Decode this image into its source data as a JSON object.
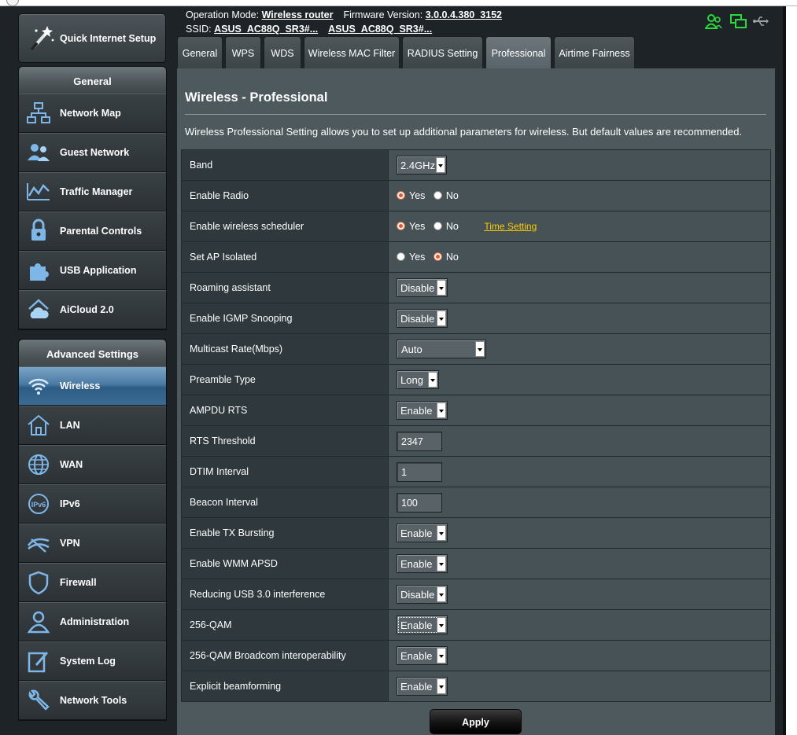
{
  "header": {
    "op_mode_label": "Operation Mode:",
    "op_mode_value": "Wireless router",
    "fw_label": "Firmware Version:",
    "fw_value": "3.0.0.4.380_3152",
    "ssid_label": "SSID:",
    "ssid_1": "ASUS_AC88Q_SR3#...",
    "ssid_2": "ASUS_AC88Q_SR3#...",
    "status_icons": [
      "client-status-icon",
      "network-status-icon",
      "usb-status-icon"
    ],
    "status_colors": {
      "active": "#2bd93a",
      "inactive": "#9aa4a8"
    }
  },
  "sidebar": {
    "qis_label": "Quick Internet Setup",
    "general_title": "General",
    "general_items": [
      {
        "label": "Network Map",
        "icon": "network-map-icon"
      },
      {
        "label": "Guest Network",
        "icon": "guest-network-icon"
      },
      {
        "label": "Traffic Manager",
        "icon": "traffic-manager-icon"
      },
      {
        "label": "Parental Controls",
        "icon": "parental-controls-icon"
      },
      {
        "label": "USB Application",
        "icon": "usb-application-icon"
      },
      {
        "label": "AiCloud 2.0",
        "icon": "aicloud-icon"
      }
    ],
    "advanced_title": "Advanced Settings",
    "advanced_items": [
      {
        "label": "Wireless",
        "icon": "wireless-icon",
        "active": true
      },
      {
        "label": "LAN",
        "icon": "lan-icon"
      },
      {
        "label": "WAN",
        "icon": "wan-icon"
      },
      {
        "label": "IPv6",
        "icon": "ipv6-icon"
      },
      {
        "label": "VPN",
        "icon": "vpn-icon"
      },
      {
        "label": "Firewall",
        "icon": "firewall-icon"
      },
      {
        "label": "Administration",
        "icon": "administration-icon"
      },
      {
        "label": "System Log",
        "icon": "system-log-icon"
      },
      {
        "label": "Network Tools",
        "icon": "network-tools-icon"
      }
    ]
  },
  "tabs": [
    {
      "label": "General"
    },
    {
      "label": "WPS"
    },
    {
      "label": "WDS"
    },
    {
      "label": "Wireless MAC Filter"
    },
    {
      "label": "RADIUS Setting"
    },
    {
      "label": "Professional",
      "active": true
    },
    {
      "label": "Airtime Fairness"
    }
  ],
  "main": {
    "title": "Wireless - Professional",
    "description": "Wireless Professional Setting allows you to set up additional parameters for wireless. But default values are recommended.",
    "yes_label": "Yes",
    "no_label": "No",
    "time_setting_link": "Time Setting",
    "apply_label": "Apply",
    "fields": {
      "band": {
        "label": "Band",
        "value": "2.4GHz"
      },
      "enable_radio": {
        "label": "Enable Radio",
        "value": "Yes"
      },
      "scheduler": {
        "label": "Enable wireless scheduler",
        "value": "Yes"
      },
      "ap_isolated": {
        "label": "Set AP Isolated",
        "value": "No"
      },
      "roaming": {
        "label": "Roaming assistant",
        "value": "Disable"
      },
      "igmp": {
        "label": "Enable IGMP Snooping",
        "value": "Disable"
      },
      "multicast": {
        "label": "Multicast Rate(Mbps)",
        "value": "Auto"
      },
      "preamble": {
        "label": "Preamble Type",
        "value": "Long"
      },
      "ampdu_rts": {
        "label": "AMPDU RTS",
        "value": "Enable"
      },
      "rts_threshold": {
        "label": "RTS Threshold",
        "value": "2347"
      },
      "dtim": {
        "label": "DTIM Interval",
        "value": "1"
      },
      "beacon": {
        "label": "Beacon Interval",
        "value": "100"
      },
      "tx_bursting": {
        "label": "Enable TX Bursting",
        "value": "Enable"
      },
      "wmm_apsd": {
        "label": "Enable WMM APSD",
        "value": "Enable"
      },
      "usb3": {
        "label": "Reducing USB 3.0 interference",
        "value": "Disable"
      },
      "qam256": {
        "label": "256-QAM",
        "value": "Enable"
      },
      "qam256_bcm": {
        "label": "256-QAM Broadcom interoperability",
        "value": "Enable"
      },
      "beamforming": {
        "label": "Explicit beamforming",
        "value": "Enable"
      }
    }
  }
}
